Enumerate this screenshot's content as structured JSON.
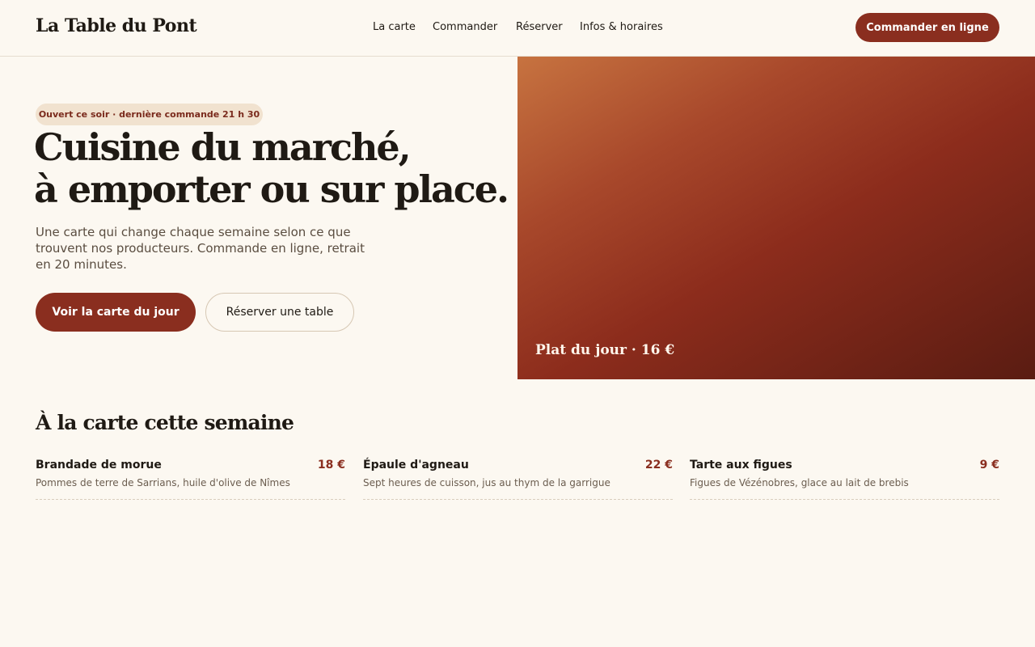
{
  "header": {
    "brand": "La Table du Pont",
    "nav": [
      "La carte",
      "Commander",
      "Réserver",
      "Infos & horaires"
    ],
    "cta": "Commander en ligne"
  },
  "hero": {
    "badge": "Ouvert ce soir · dernière commande 21 h 30",
    "title_line1": "Cuisine du marché,",
    "title_line2": "à emporter ou sur place.",
    "subtitle": "Une carte qui change chaque semaine selon ce que trouvent nos producteurs. Commande en ligne, retrait en 20 minutes.",
    "primary_button": "Voir la carte du jour",
    "secondary_button": "Réserver une table",
    "image_caption": "Plat du jour · 16 €"
  },
  "menu": {
    "title": "À la carte cette semaine",
    "items": [
      {
        "name": "Brandade de morue",
        "price": "18 €",
        "description": "Pommes de terre de Sarrians, huile d'olive de Nîmes"
      },
      {
        "name": "Épaule d'agneau",
        "price": "22 €",
        "description": "Sept heures de cuisson, jus au thym de la garrigue"
      },
      {
        "name": "Tarte aux figues",
        "price": "9 €",
        "description": "Figues de Vézénobres, glace au lait de brebis"
      }
    ]
  },
  "colors": {
    "accent": "#8a2e1f",
    "background": "#fcf8f1",
    "badge_bg": "#f1e2cf"
  }
}
